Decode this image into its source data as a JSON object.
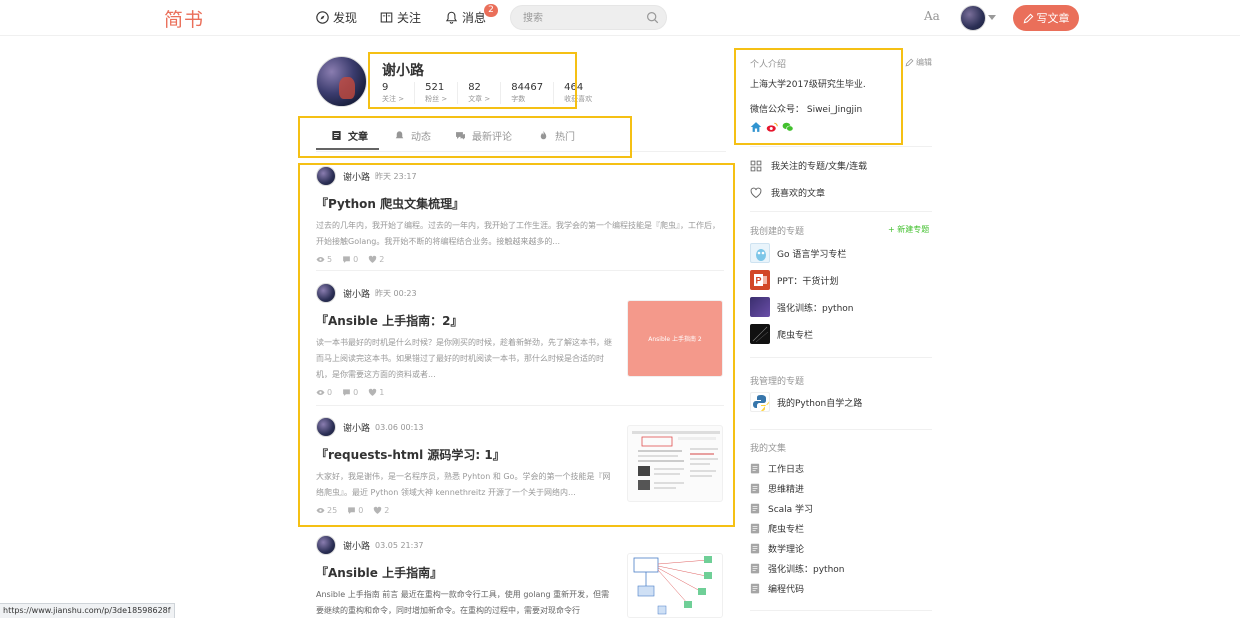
{
  "header": {
    "logo": "简书",
    "nav": {
      "discover": "发现",
      "follow": "关注",
      "messages": "消息",
      "messages_badge": "2"
    },
    "search_placeholder": "搜索",
    "font_toggle": "Aa",
    "write_label": "写文章"
  },
  "profile": {
    "name": "谢小路",
    "stats": [
      {
        "value": "9",
        "label": "关注 >"
      },
      {
        "value": "521",
        "label": "粉丝 >"
      },
      {
        "value": "82",
        "label": "文章 >"
      },
      {
        "value": "84467",
        "label": "字数"
      },
      {
        "value": "464",
        "label": "收获喜欢"
      }
    ]
  },
  "tabs": [
    "文章",
    "动态",
    "最新评论",
    "热门"
  ],
  "articles": [
    {
      "author": "谢小路",
      "time": "昨天 23:17",
      "title": "『Python 爬虫文集梳理』",
      "abstract": "过去的几年内，我开始了编程。过去的一年内，我开始了工作生涯。我学会的第一个编程技能是『爬虫』，工作后，开始接触Golang。我开始不断的将编程结合业务。接触越来越多的...",
      "views": "5",
      "comments": "0",
      "likes": "2"
    },
    {
      "author": "谢小路",
      "time": "昨天 00:23",
      "title": "『Ansible 上手指南：2』",
      "abstract": "读一本书最好的时机是什么时候？是你刚买的时候，趁着新鲜劲，先了解这本书，继而马上阅读完这本书。如果错过了最好的时机阅读一本书，那什么时候是合适的时机，是你需要这方面的资料或者...",
      "thumb_text": "Ansible 上手指南 2",
      "views": "0",
      "comments": "0",
      "likes": "1"
    },
    {
      "author": "谢小路",
      "time": "03.06 00:13",
      "title": "『requests-html 源码学习: 1』",
      "abstract": "大家好，我是谢伟，是一名程序员，熟悉 Pyhton 和 Go。学会的第一个技能是『网络爬虫』。最近 Python 领域大神 kennethreitz 开源了一个关于网络内...",
      "views": "25",
      "comments": "0",
      "likes": "2"
    },
    {
      "author": "谢小路",
      "time": "03.05 21:37",
      "title": "『Ansible 上手指南』",
      "abstract": "Ansible 上手指南 前言 最近在重构一款命令行工具，使用 golang 重新开发，但需要继续的重构和命令，同时增加新命令。在重构的过程中，需要对现命令行"
    }
  ],
  "sidebar": {
    "intro_title": "个人介绍",
    "edit_label": "编辑",
    "intro_line1": "上海大学2017级研究生毕业.",
    "intro_line2": "微信公众号： Siwei_Jingjin",
    "links": [
      "我关注的专题/文集/连载",
      "我喜欢的文章"
    ],
    "created_title": "我创建的专题",
    "new_topic": "+ 新建专题",
    "created": [
      "Go 语言学习专栏",
      "PPT：干货计划",
      "强化训练：python",
      "爬虫专栏"
    ],
    "managed_title": "我管理的专题",
    "managed": [
      "我的Python自学之路"
    ],
    "notebooks_title": "我的文集",
    "notebooks": [
      "工作日志",
      "思维精进",
      "Scala 学习",
      "爬虫专栏",
      "数学理论",
      "强化训练：python",
      "编程代码"
    ]
  },
  "status_url": "https://www.jianshu.com/p/3de18598628f",
  "colors": {
    "brand": "#ea6f5a",
    "highlight": "#f5c014",
    "green": "#42c02e"
  }
}
